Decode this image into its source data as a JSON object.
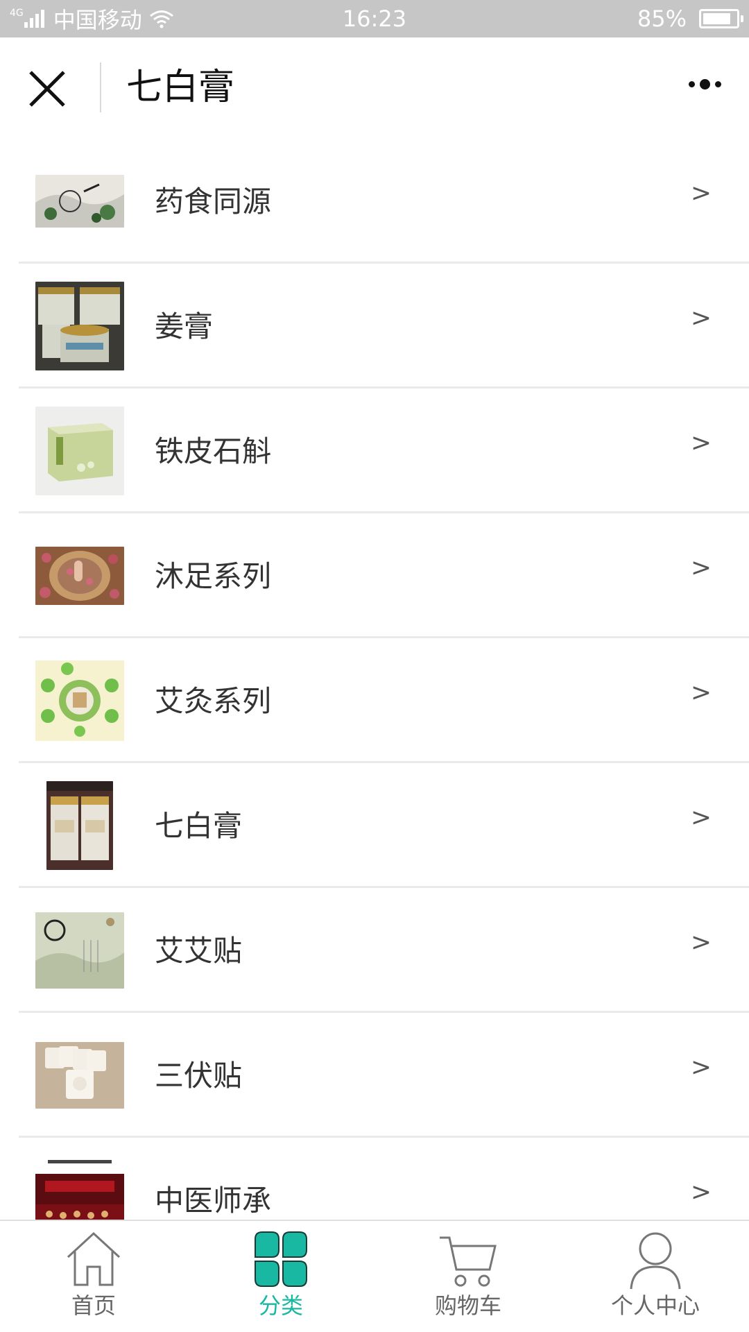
{
  "status_bar": {
    "network": "4G",
    "carrier": "中国移动",
    "time": "16:23",
    "battery": "85%",
    "battery_level": 0.85
  },
  "nav": {
    "title": "七白膏",
    "close_icon": "close-icon",
    "more_icon": "more-icon"
  },
  "categories": [
    {
      "label": "药食同源",
      "thumb": "ink-painting-thumbnail"
    },
    {
      "label": "姜膏",
      "thumb": "ginger-paste-jars-thumbnail"
    },
    {
      "label": "铁皮石斛",
      "thumb": "dendrobium-box-thumbnail"
    },
    {
      "label": "沐足系列",
      "thumb": "foot-bath-thumbnail"
    },
    {
      "label": "艾灸系列",
      "thumb": "moxibustion-thumbnail"
    },
    {
      "label": "七白膏",
      "thumb": "qibai-cream-thumbnail"
    },
    {
      "label": "艾艾贴",
      "thumb": "aiai-patch-thumbnail"
    },
    {
      "label": "三伏贴",
      "thumb": "sanfu-patch-thumbnail"
    },
    {
      "label": "中医师承",
      "thumb": "tcm-ceremony-thumbnail"
    }
  ],
  "chevron": ">",
  "tabs": [
    {
      "label": "首页",
      "icon": "home-icon",
      "active": false
    },
    {
      "label": "分类",
      "icon": "category-icon",
      "active": true
    },
    {
      "label": "购物车",
      "icon": "cart-icon",
      "active": false
    },
    {
      "label": "个人中心",
      "icon": "user-icon",
      "active": false
    }
  ],
  "colors": {
    "accent": "#18b8a3",
    "status_bar_bg": "#c6c6c6",
    "divider": "#eaeaea"
  }
}
